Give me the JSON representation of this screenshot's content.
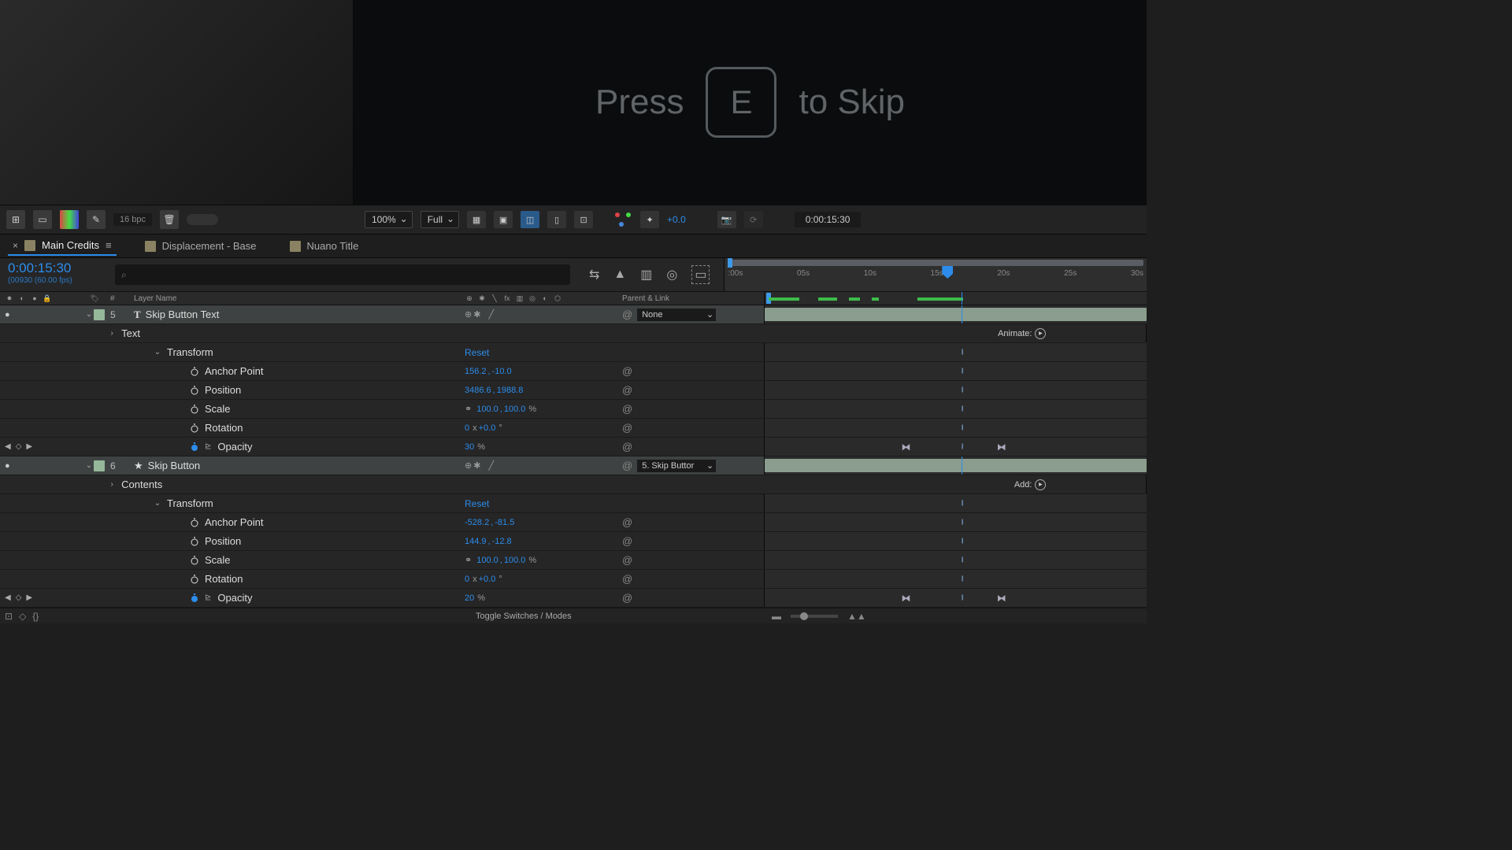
{
  "viewer": {
    "prompt_pre": "Press",
    "key": "E",
    "prompt_post": "to Skip",
    "zoom": "100%",
    "resolution": "Full",
    "exposure": "+0.0",
    "time": "0:00:15:30",
    "bpc": "16 bpc"
  },
  "tabs": [
    {
      "label": "Main Credits",
      "active": true
    },
    {
      "label": "Displacement - Base",
      "active": false
    },
    {
      "label": "Nuano Title",
      "active": false
    }
  ],
  "timeline": {
    "timecode": "0:00:15:30",
    "subtime": "(00930 (60.00 fps)",
    "ruler": [
      ":00s",
      "05s",
      "10s",
      "15s",
      "20s",
      "25s",
      "30s"
    ],
    "playhead_pct": 51.5
  },
  "columns": {
    "layer_name": "Layer Name",
    "parent": "Parent & Link",
    "hash": "#"
  },
  "labels": {
    "animate": "Animate:",
    "add": "Add:",
    "reset": "Reset",
    "none": "None",
    "toggle": "Toggle Switches / Modes"
  },
  "layer5": {
    "num": "5",
    "name": "Skip Button Text",
    "text_group": "Text",
    "transform": "Transform",
    "anchor": {
      "label": "Anchor Point",
      "x": "156.2",
      "y": "-10.0"
    },
    "position": {
      "label": "Position",
      "x": "3486.6",
      "y": "1988.8"
    },
    "scale": {
      "label": "Scale",
      "x": "100.0",
      "y": "100.0",
      "unit": "%"
    },
    "rotation": {
      "label": "Rotation",
      "turns": "0",
      "deg": "+0.0",
      "unit": "°"
    },
    "opacity": {
      "label": "Opacity",
      "v": "30",
      "unit": "%"
    }
  },
  "layer6": {
    "num": "6",
    "name": "Skip Button",
    "parent": "5. Skip Buttor",
    "contents": "Contents",
    "transform": "Transform",
    "anchor": {
      "label": "Anchor Point",
      "x": "-528.2",
      "y": "-81.5"
    },
    "position": {
      "label": "Position",
      "x": "144.9",
      "y": "-12.8"
    },
    "scale": {
      "label": "Scale",
      "x": "100.0",
      "y": "100.0",
      "unit": "%"
    },
    "rotation": {
      "label": "Rotation",
      "turns": "0",
      "deg": "+0.0",
      "unit": "°"
    },
    "opacity": {
      "label": "Opacity",
      "v": "20",
      "unit": "%"
    }
  }
}
